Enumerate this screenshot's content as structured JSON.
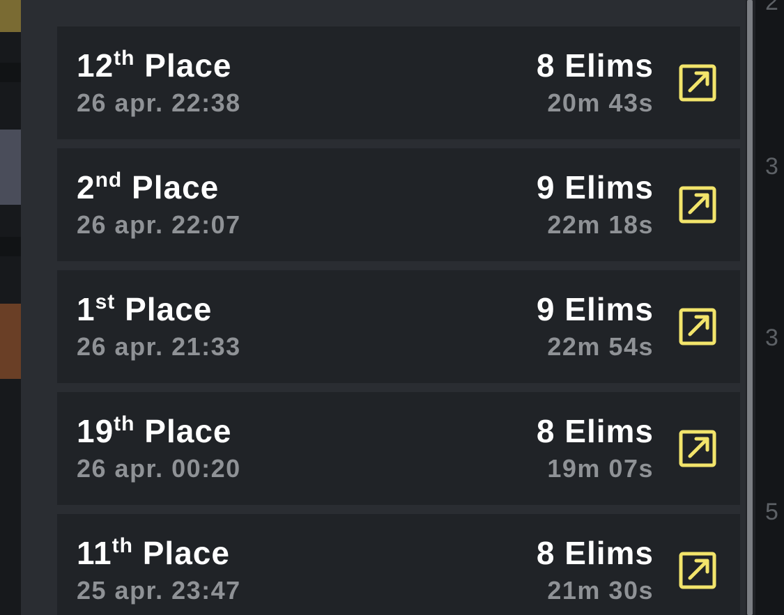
{
  "matches": [
    {
      "place_num": "12",
      "place_suffix": "th",
      "place_word": "Place",
      "datetime": "26 apr. 22:38",
      "elims": "8 Elims",
      "duration": "20m 43s"
    },
    {
      "place_num": "2",
      "place_suffix": "nd",
      "place_word": "Place",
      "datetime": "26 apr. 22:07",
      "elims": "9 Elims",
      "duration": "22m 18s"
    },
    {
      "place_num": "1",
      "place_suffix": "st",
      "place_word": "Place",
      "datetime": "26 apr. 21:33",
      "elims": "9 Elims",
      "duration": "22m 54s"
    },
    {
      "place_num": "19",
      "place_suffix": "th",
      "place_word": "Place",
      "datetime": "26 apr. 00:20",
      "elims": "8 Elims",
      "duration": "19m 07s"
    },
    {
      "place_num": "11",
      "place_suffix": "th",
      "place_word": "Place",
      "datetime": "25 apr. 23:47",
      "elims": "8 Elims",
      "duration": "21m 30s"
    }
  ],
  "background_right": [
    "2",
    "3",
    "3",
    "5"
  ],
  "icons": {
    "open": "external-link-icon"
  },
  "colors": {
    "accent": "#f2e46b",
    "card_bg": "#202327",
    "panel_bg": "#2a2d32",
    "text_primary": "#ffffff",
    "text_secondary": "#8f9296"
  }
}
